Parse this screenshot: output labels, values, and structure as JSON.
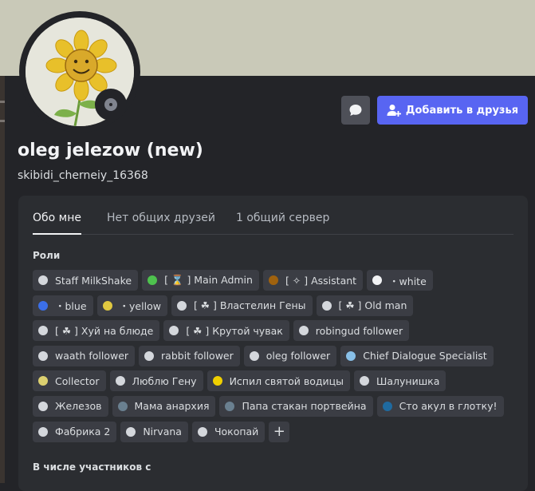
{
  "profile": {
    "display_name": "oleg jelezow (new)",
    "username": "skibidi_cherneiy_16368",
    "status": "offline",
    "avatar_icon": "sunflower-drawing",
    "banner_color": "#c9c9b8"
  },
  "actions": {
    "message_icon": "chat-bubble-icon",
    "add_friend_label": "Добавить в друзья",
    "add_friend_icon": "person-add-icon"
  },
  "tabs": [
    {
      "label": "Обо мне",
      "active": true
    },
    {
      "label": "Нет общих друзей",
      "active": false
    },
    {
      "label": "1 общий сервер",
      "active": false
    }
  ],
  "roles_title": "Роли",
  "roles": [
    [
      {
        "name": "Staff MilkShake",
        "color": "#d4d7dc"
      },
      {
        "name": "[ ⌛ ]   Main Admin",
        "color": "#4ec24e"
      },
      {
        "name": "[ ✧ ]   Assistant",
        "color": "#a0620e"
      },
      {
        "name": "・white",
        "color": "#f2f3f5"
      }
    ],
    [
      {
        "name": "・blue",
        "color": "#3b6fe8"
      },
      {
        "name": "・yellow",
        "color": "#e0c840"
      },
      {
        "name": "[ ☘ ]   Властелин Гены",
        "color": "#d4d7dc"
      },
      {
        "name": "[ ☘ ]   Old man",
        "color": "#d4d7dc"
      }
    ],
    [
      {
        "name": "[ ☘ ]   Хуй на блюде",
        "color": "#d4d7dc"
      },
      {
        "name": "[ ☘ ]   Крутой чувак",
        "color": "#d4d7dc"
      },
      {
        "name": "robingud follower",
        "color": "#d4d7dc"
      }
    ],
    [
      {
        "name": "waath follower",
        "color": "#d4d7dc"
      },
      {
        "name": "rabbit follower",
        "color": "#d4d7dc"
      },
      {
        "name": "oleg follower",
        "color": "#d4d7dc"
      },
      {
        "name": "Chief Dialogue Specialist",
        "color": "#88c0e8"
      }
    ],
    [
      {
        "name": "Collector",
        "color": "#dcd070"
      },
      {
        "name": "Люблю Гену",
        "color": "#d4d7dc"
      },
      {
        "name": "Испил святой водицы",
        "color": "#f0d000"
      },
      {
        "name": "Шалунишка",
        "color": "#d4d7dc"
      }
    ],
    [
      {
        "name": "Железов",
        "color": "#d4d7dc"
      },
      {
        "name": "Мама анархия",
        "color": "#6a8090"
      },
      {
        "name": "Папа стакан портвейна",
        "color": "#6a8090"
      },
      {
        "name": "Сто акул в глотку!",
        "color": "#1f6aa0"
      }
    ],
    [
      {
        "name": "Фабрика 2",
        "color": "#d4d7dc"
      },
      {
        "name": "Nirvana",
        "color": "#d4d7dc"
      },
      {
        "name": "Чокопай",
        "color": "#d4d7dc"
      }
    ]
  ],
  "add_role_label": "+",
  "member_since_title": "В числе участников с"
}
